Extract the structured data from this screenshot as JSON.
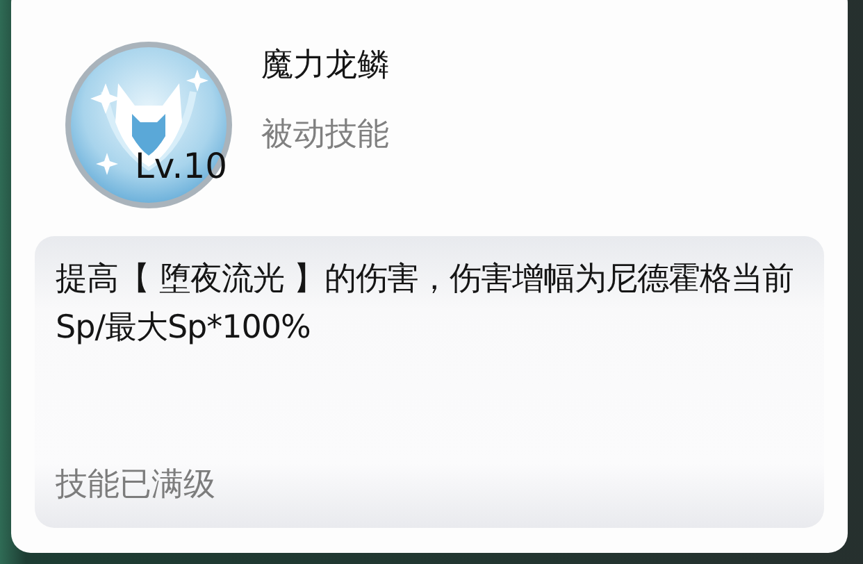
{
  "skill": {
    "name": "魔力龙鳞",
    "type": "被动技能",
    "level": "Lv.10"
  },
  "description": "提高【 堕夜流光 】的伤害，伤害增幅为尼德霍格当前Sp/最大Sp*100%",
  "status": "技能已满级"
}
